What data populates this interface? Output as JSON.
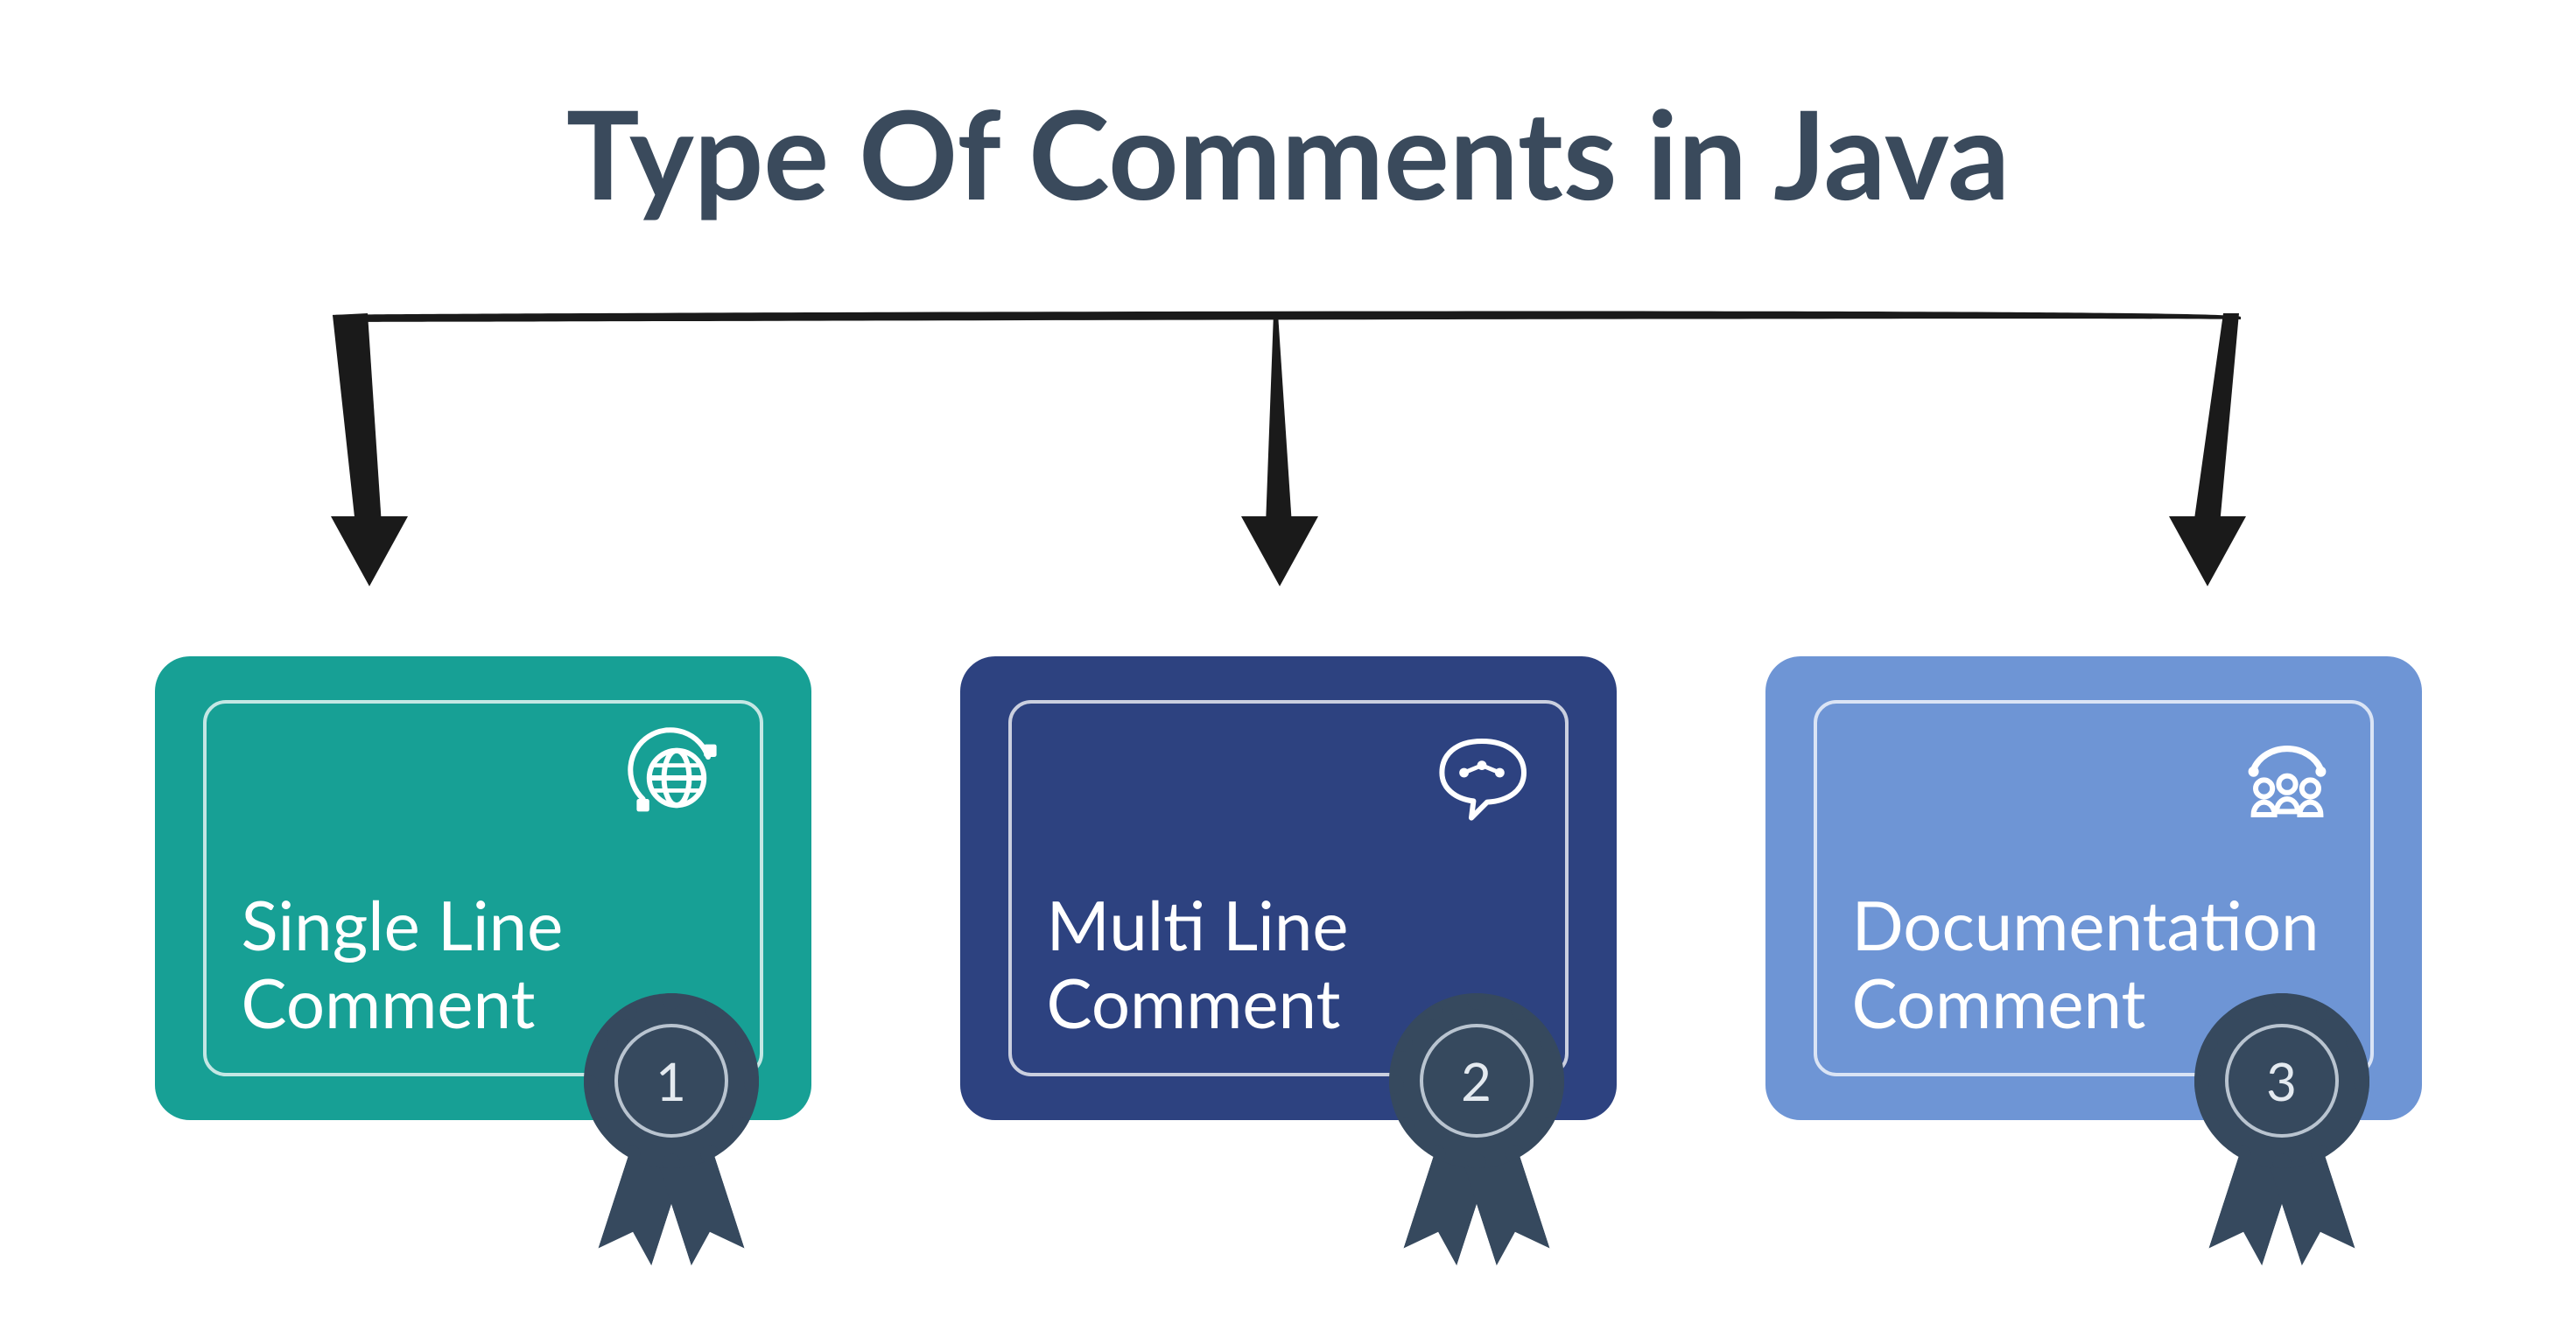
{
  "title": "Type Of Comments in Java",
  "colors": {
    "title": "#3a4a5c",
    "badge_bg": "#36495e"
  },
  "cards": [
    {
      "label_line1": "Single Line",
      "label_line2": "Comment",
      "number": "1",
      "bg": "#17a095",
      "icon": "globe-loop-icon"
    },
    {
      "label_line1": "Multi Line",
      "label_line2": "Comment",
      "number": "2",
      "bg": "#2d4280",
      "icon": "speech-bubble-icon"
    },
    {
      "label_line1": "Documentation",
      "label_line2": "Comment",
      "number": "3",
      "bg": "#6e95d5",
      "icon": "team-icon"
    }
  ]
}
